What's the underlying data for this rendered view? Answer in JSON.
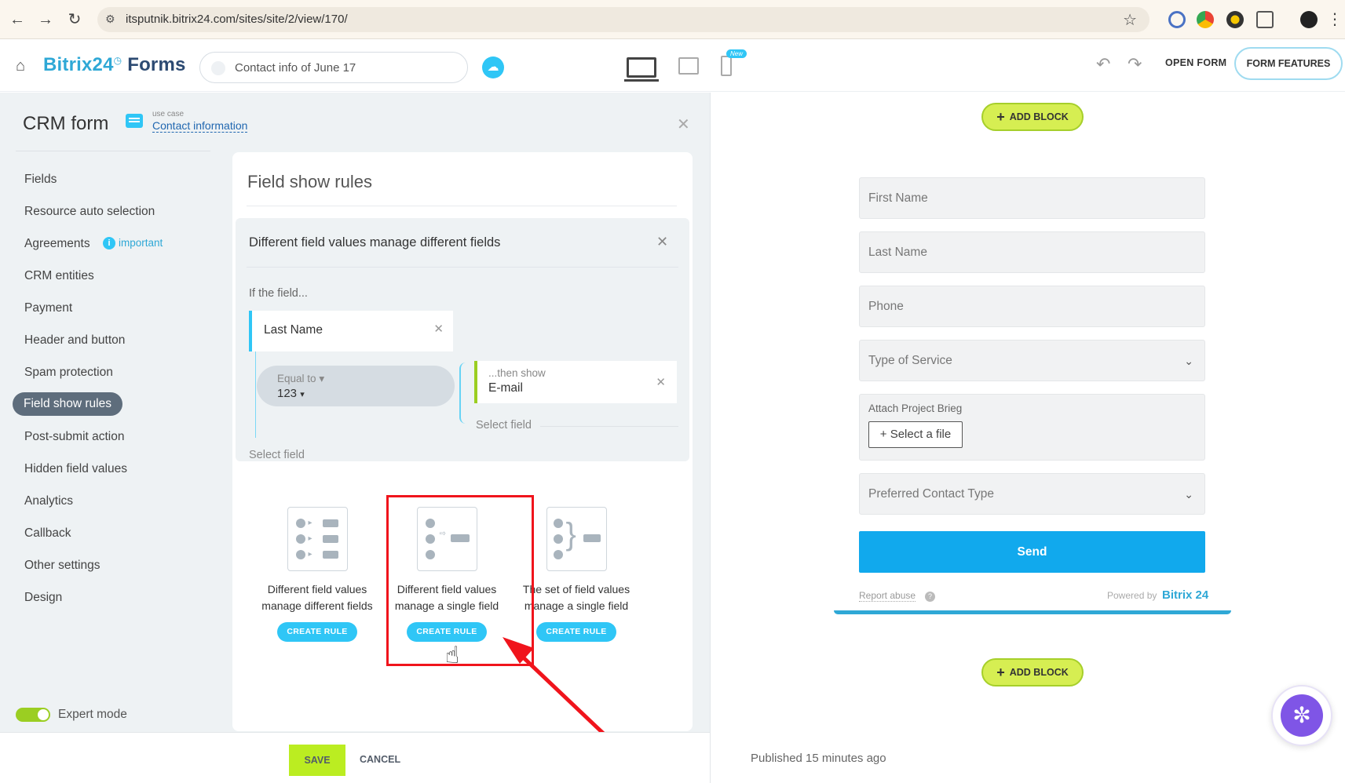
{
  "browser": {
    "url": "itsputnik.bitrix24.com/sites/site/2/view/170/"
  },
  "header": {
    "brand": "Bitrix24",
    "brand_suffix": "Forms",
    "form_name": "Contact info of June 17",
    "new_badge": "New",
    "open_form": "OPEN FORM",
    "form_features": "FORM FEATURES"
  },
  "settings": {
    "title": "CRM form",
    "use_case_label": "use case",
    "use_case_value": "Contact information",
    "menu": [
      "Fields",
      "Resource auto selection",
      "Agreements",
      "CRM entities",
      "Payment",
      "Header and button",
      "Spam protection",
      "Field show rules",
      "Post-submit action",
      "Hidden field values",
      "Analytics",
      "Callback",
      "Other settings",
      "Design"
    ],
    "active_menu_index": 7,
    "agreements_badge": "important",
    "expert_mode": "Expert mode"
  },
  "rules": {
    "title": "Field show rules",
    "rule_name": "Different field values manage different fields",
    "if_field_label": "If the field...",
    "if_field_value": "Last Name",
    "condition_label": "Equal to",
    "condition_value": "123",
    "then_label": "...then show",
    "then_value": "E-mail",
    "select_field_right": "Select field",
    "select_field_left": "Select field",
    "templates": [
      {
        "line1": "Different field values",
        "line2": "manage different fields",
        "button": "CREATE RULE"
      },
      {
        "line1": "Different field values",
        "line2": "manage a single field",
        "button": "CREATE RULE"
      },
      {
        "line1": "The set of field values",
        "line2": "manage a single field",
        "button": "CREATE RULE"
      }
    ]
  },
  "footer": {
    "save": "SAVE",
    "cancel": "CANCEL",
    "published": "Published 15 minutes ago"
  },
  "preview": {
    "add_block": "ADD BLOCK",
    "fields": {
      "first_name": "First Name",
      "last_name": "Last Name",
      "phone": "Phone",
      "type_of_service": "Type of Service",
      "attach_label": "Attach Project Brieg",
      "select_file": "Select a file",
      "preferred_contact": "Preferred Contact Type"
    },
    "send": "Send",
    "report_abuse": "Report abuse",
    "powered_by": "Powered by",
    "powered_brand": "Bitrix 24"
  },
  "colors": {
    "accent": "#2fc6f6",
    "save_green": "#bbed21",
    "send_blue": "#11a9ed",
    "highlight_red": "#f0141c"
  }
}
